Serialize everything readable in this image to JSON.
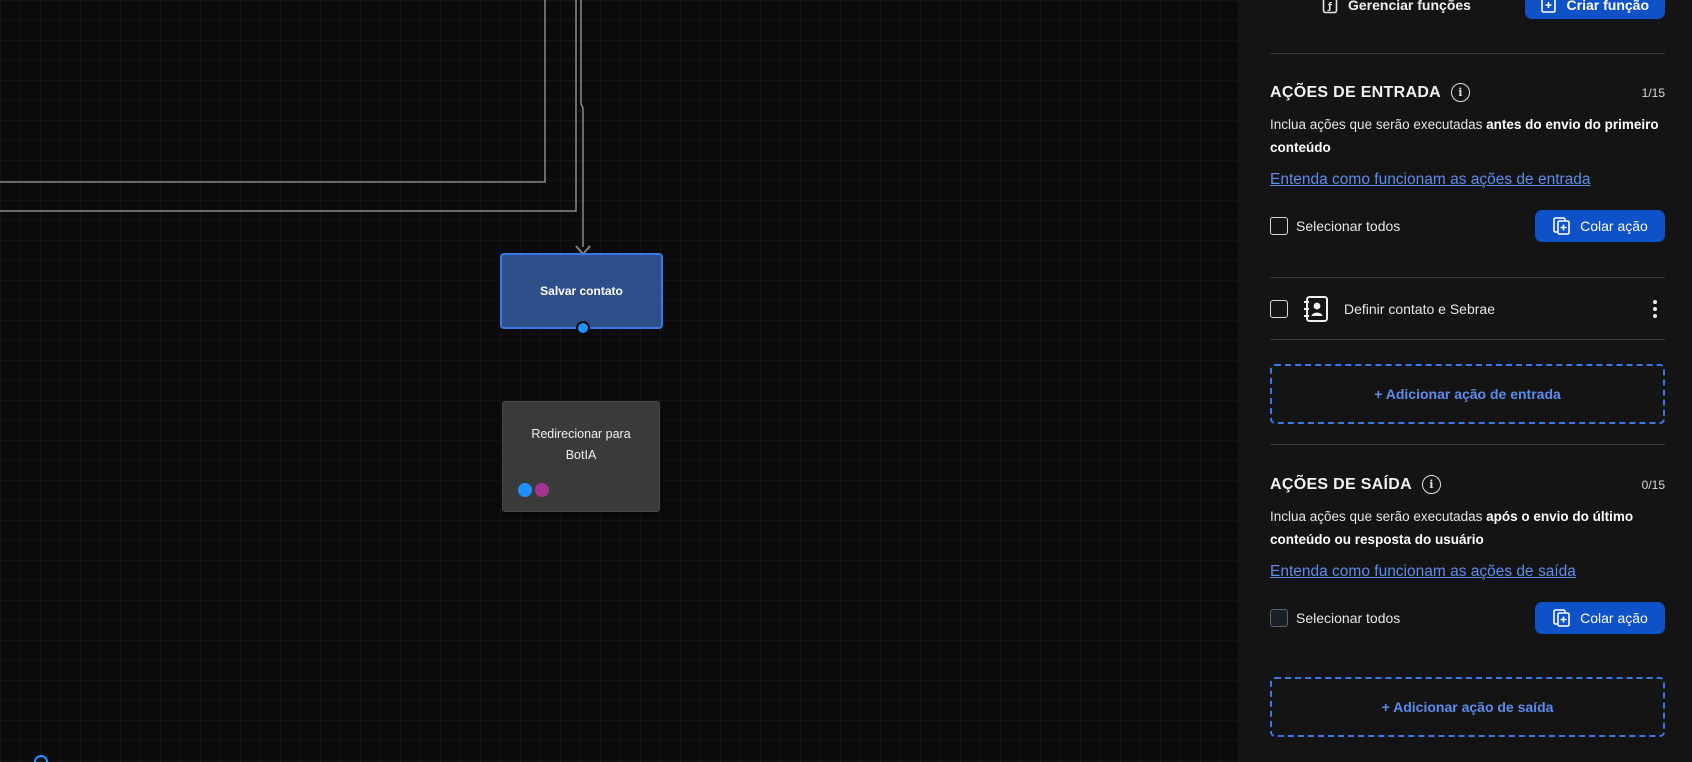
{
  "canvas": {
    "nodes": {
      "save_contact": {
        "label": "Salvar contato"
      },
      "redirect": {
        "label_line1": "Redirecionar para",
        "label_line2": "BotIA"
      }
    }
  },
  "panel": {
    "top": {
      "manage_functions_label": "Gerenciar funções",
      "create_function_label": "Criar função"
    },
    "entry": {
      "title": "AÇÕES DE ENTRADA",
      "count": "1/15",
      "desc_prefix": "Inclua ações que serão executadas ",
      "desc_bold": "antes do envio do primeiro conteúdo",
      "help_link": "Entenda como funcionam as ações de entrada",
      "select_all": "Selecionar todos",
      "paste_label": "Colar ação",
      "items": [
        {
          "label": "Definir contato e Sebrae"
        }
      ],
      "add_label": "+ Adicionar ação de entrada"
    },
    "exit": {
      "title": "AÇÕES DE SAÍDA",
      "count": "0/15",
      "desc_prefix": "Inclua ações que serão executadas ",
      "desc_bold": "após o envio do último conteúdo ou resposta do usuário",
      "help_link": "Entenda como funcionam as ações de saída",
      "select_all": "Selecionar todos",
      "paste_label": "Colar ação",
      "add_label": "+ Adicionar ação de saída"
    }
  },
  "colors": {
    "accent": "#0f52c7",
    "link": "#5b8def",
    "node_selected": "#2d4f8a",
    "node_default": "#3a3a3a",
    "handle_blue": "#1e90ff",
    "handle_purple": "#a2348f"
  }
}
